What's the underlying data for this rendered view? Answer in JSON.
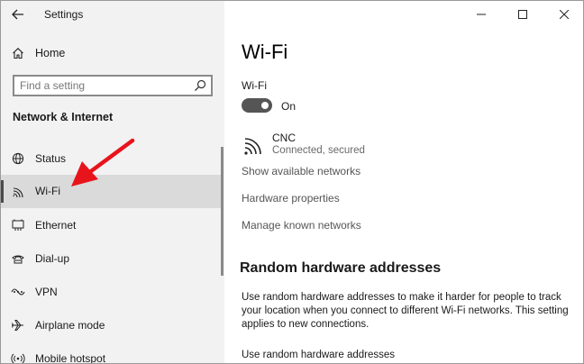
{
  "app": {
    "title": "Settings"
  },
  "sidebar": {
    "home_label": "Home",
    "search_placeholder": "Find a setting",
    "section_title": "Network & Internet",
    "items": [
      {
        "label": "Status",
        "icon": "globe-icon"
      },
      {
        "label": "Wi-Fi",
        "icon": "wifi-icon",
        "selected": true
      },
      {
        "label": "Ethernet",
        "icon": "ethernet-icon"
      },
      {
        "label": "Dial-up",
        "icon": "dial-up-icon"
      },
      {
        "label": "VPN",
        "icon": "vpn-icon"
      },
      {
        "label": "Airplane mode",
        "icon": "airplane-icon"
      },
      {
        "label": "Mobile hotspot",
        "icon": "hotspot-icon"
      }
    ]
  },
  "main": {
    "title": "Wi-Fi",
    "wifi_label": "Wi-Fi",
    "toggle_state": "On",
    "network": {
      "name": "CNC",
      "status": "Connected, secured"
    },
    "links": {
      "show_networks": "Show available networks",
      "hardware_properties": "Hardware properties",
      "manage_networks": "Manage known networks"
    },
    "random_hw": {
      "heading": "Random hardware addresses",
      "description": "Use random hardware addresses to make it harder for people to track your location when you connect to different Wi-Fi networks. This setting applies to new connections.",
      "setting_label": "Use random hardware addresses"
    }
  },
  "colors": {
    "sidebar_bg": "#f2f2f2",
    "selected_bg": "#dadada",
    "toggle_on": "#555555",
    "annotation": "#e8141c"
  }
}
